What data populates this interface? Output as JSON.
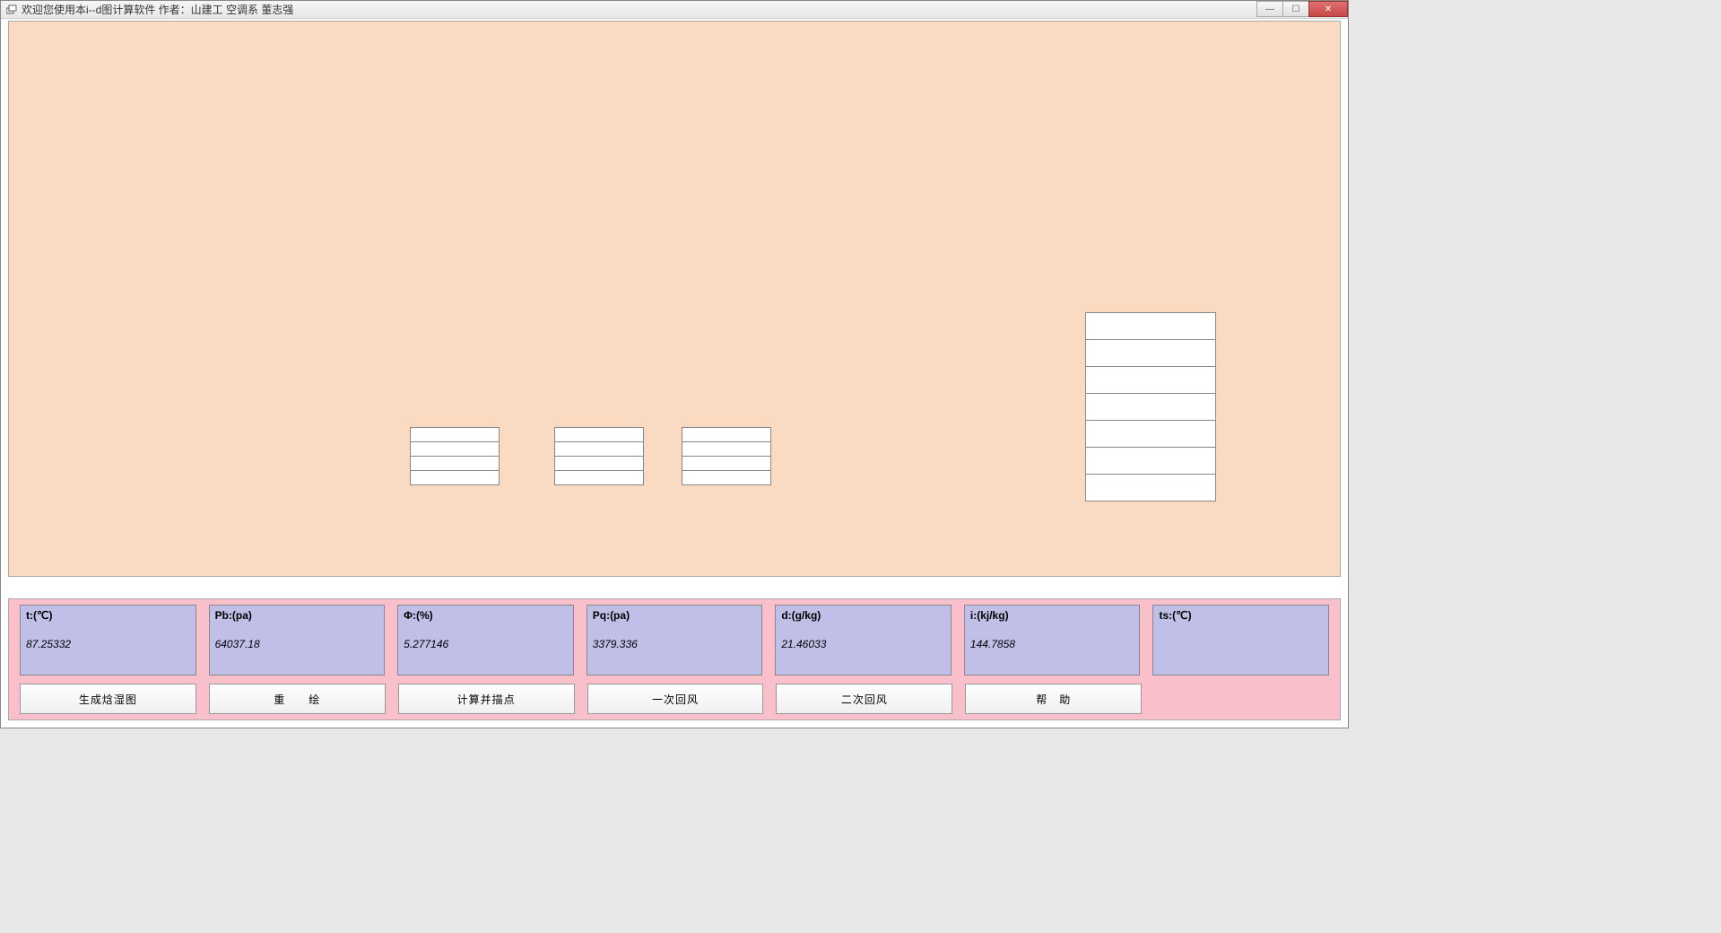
{
  "title": "欢迎您使用本i--d图计算软件      作者：山建工 空调系 董志强",
  "values": {
    "t": {
      "label": "t:(℃)",
      "value": "87.25332"
    },
    "pb": {
      "label": "Pb:(pa)",
      "value": "64037.18"
    },
    "phi": {
      "label": "Φ:(%)",
      "value": "5.277146"
    },
    "pq": {
      "label": "Pq:(pa)",
      "value": "3379.336"
    },
    "d": {
      "label": "d:(g/kg)",
      "value": "21.46033"
    },
    "i": {
      "label": "i:(kj/kg)",
      "value": "144.7858"
    },
    "ts": {
      "label": "ts:(℃)",
      "value": ""
    }
  },
  "buttons": {
    "generate": "生成焓湿图",
    "redraw": "重　　绘",
    "calc": "计算并描点",
    "air1": "一次回风",
    "air2": "二次回风",
    "help": "帮　助"
  }
}
